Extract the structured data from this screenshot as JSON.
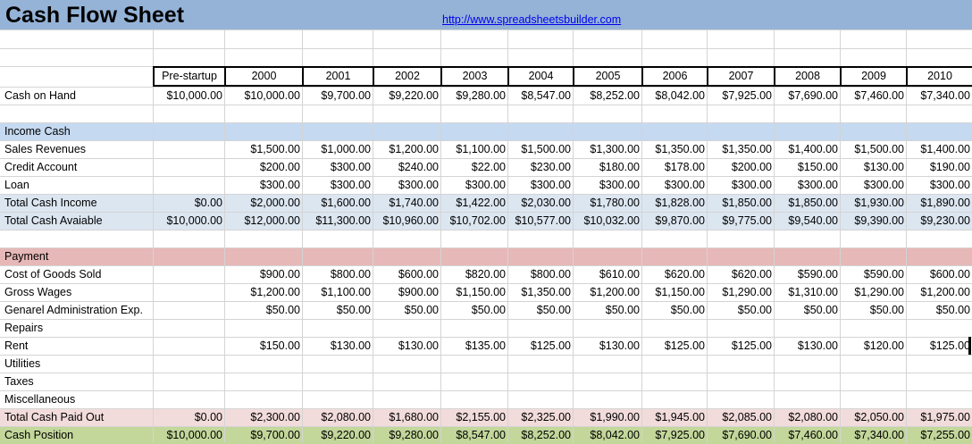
{
  "header": {
    "title": "Cash Flow Sheet",
    "link": "http://www.spreadsheetsbuilder.com"
  },
  "columns": [
    "Pre-startup",
    "2000",
    "2001",
    "2002",
    "2003",
    "2004",
    "2005",
    "2006",
    "2007",
    "2008",
    "2009",
    "2010"
  ],
  "rows": [
    {
      "label": "Cash on Hand",
      "band": "none",
      "values": [
        "$10,000.00",
        "$10,000.00",
        "$9,700.00",
        "$9,220.00",
        "$9,280.00",
        "$8,547.00",
        "$8,252.00",
        "$8,042.00",
        "$7,925.00",
        "$7,690.00",
        "$7,460.00",
        "$7,340.00"
      ]
    },
    {
      "label": "",
      "band": "none",
      "values": []
    },
    {
      "label": "Income Cash",
      "band": "blue",
      "values": []
    },
    {
      "label": "Sales Revenues",
      "band": "none",
      "values": [
        "",
        "$1,500.00",
        "$1,000.00",
        "$1,200.00",
        "$1,100.00",
        "$1,500.00",
        "$1,300.00",
        "$1,350.00",
        "$1,350.00",
        "$1,400.00",
        "$1,500.00",
        "$1,400.00"
      ]
    },
    {
      "label": "Credit Account",
      "band": "none",
      "values": [
        "",
        "$200.00",
        "$300.00",
        "$240.00",
        "$22.00",
        "$230.00",
        "$180.00",
        "$178.00",
        "$200.00",
        "$150.00",
        "$130.00",
        "$190.00"
      ]
    },
    {
      "label": "Loan",
      "band": "none",
      "values": [
        "",
        "$300.00",
        "$300.00",
        "$300.00",
        "$300.00",
        "$300.00",
        "$300.00",
        "$300.00",
        "$300.00",
        "$300.00",
        "$300.00",
        "$300.00"
      ]
    },
    {
      "label": "Total Cash Income",
      "band": "total",
      "values": [
        "$0.00",
        "$2,000.00",
        "$1,600.00",
        "$1,740.00",
        "$1,422.00",
        "$2,030.00",
        "$1,780.00",
        "$1,828.00",
        "$1,850.00",
        "$1,850.00",
        "$1,930.00",
        "$1,890.00"
      ]
    },
    {
      "label": "Total Cash Avaiable",
      "band": "total",
      "values": [
        "$10,000.00",
        "$12,000.00",
        "$11,300.00",
        "$10,960.00",
        "$10,702.00",
        "$10,577.00",
        "$10,032.00",
        "$9,870.00",
        "$9,775.00",
        "$9,540.00",
        "$9,390.00",
        "$9,230.00"
      ]
    },
    {
      "label": "",
      "band": "none",
      "values": []
    },
    {
      "label": "Payment",
      "band": "pink",
      "values": []
    },
    {
      "label": "Cost of Goods Sold",
      "band": "none",
      "values": [
        "",
        "$900.00",
        "$800.00",
        "$600.00",
        "$820.00",
        "$800.00",
        "$610.00",
        "$620.00",
        "$620.00",
        "$590.00",
        "$590.00",
        "$600.00"
      ]
    },
    {
      "label": "Gross Wages",
      "band": "none",
      "values": [
        "",
        "$1,200.00",
        "$1,100.00",
        "$900.00",
        "$1,150.00",
        "$1,350.00",
        "$1,200.00",
        "$1,150.00",
        "$1,290.00",
        "$1,310.00",
        "$1,290.00",
        "$1,200.00"
      ]
    },
    {
      "label": "Genarel Administration Exp.",
      "band": "none",
      "values": [
        "",
        "$50.00",
        "$50.00",
        "$50.00",
        "$50.00",
        "$50.00",
        "$50.00",
        "$50.00",
        "$50.00",
        "$50.00",
        "$50.00",
        "$50.00"
      ]
    },
    {
      "label": "Repairs",
      "band": "none",
      "values": []
    },
    {
      "label": "Rent",
      "band": "none",
      "values": [
        "",
        "$150.00",
        "$130.00",
        "$130.00",
        "$135.00",
        "$125.00",
        "$130.00",
        "$125.00",
        "$125.00",
        "$130.00",
        "$120.00",
        "$125.00"
      ]
    },
    {
      "label": "Utilities",
      "band": "none",
      "values": []
    },
    {
      "label": "Taxes",
      "band": "none",
      "values": []
    },
    {
      "label": "Miscellaneous",
      "band": "none",
      "values": []
    },
    {
      "label": "Total Cash Paid Out",
      "band": "lpink",
      "values": [
        "$0.00",
        "$2,300.00",
        "$2,080.00",
        "$1,680.00",
        "$2,155.00",
        "$2,325.00",
        "$1,990.00",
        "$1,945.00",
        "$2,085.00",
        "$2,080.00",
        "$2,050.00",
        "$1,975.00"
      ]
    },
    {
      "label": "Cash Position",
      "band": "green",
      "values": [
        "$10,000.00",
        "$9,700.00",
        "$9,220.00",
        "$9,280.00",
        "$8,547.00",
        "$8,252.00",
        "$8,042.00",
        "$7,925.00",
        "$7,690.00",
        "$7,460.00",
        "$7,340.00",
        "$7,255.00"
      ]
    }
  ],
  "colors": {
    "title_band": "#95b3d7",
    "income_band": "#c5d9f1",
    "total_band": "#dce6f1",
    "payment_band": "#e6b8b7",
    "paid_out_band": "#f2dcdb",
    "cash_position_band": "#c4d79b",
    "link": "#0000ee"
  }
}
